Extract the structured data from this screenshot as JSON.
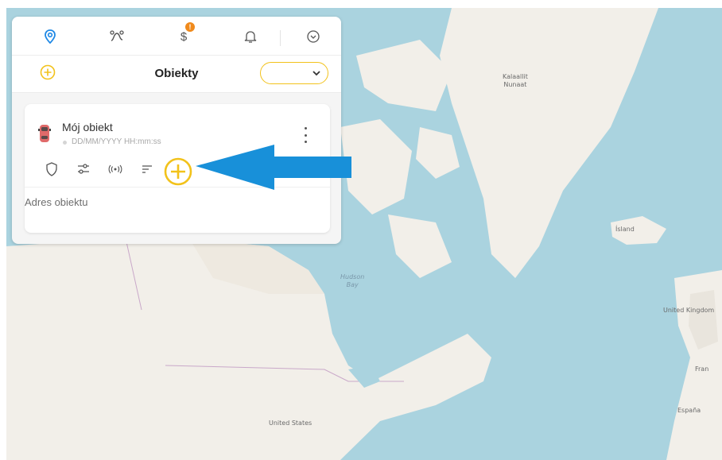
{
  "nav": {
    "tabs": [
      {
        "icon": "location-pin-icon",
        "active": true
      },
      {
        "icon": "route-icon"
      },
      {
        "icon": "dollar-icon",
        "badge": "!"
      },
      {
        "icon": "bell-icon"
      },
      {
        "icon": "chevron-circle-icon"
      }
    ]
  },
  "header": {
    "title": "Obiekty",
    "add_icon": "plus-circle-icon",
    "select_value": ""
  },
  "object": {
    "name": "Mój obiekt",
    "timestamp": "DD/MM/YYYY HH:mm:ss",
    "address": "Adres obiektu",
    "tools": [
      "shield-icon",
      "sliders-icon",
      "signal-icon",
      "sort-icon",
      "plus-circle-icon"
    ]
  },
  "map": {
    "labels": {
      "greenland": "Kalaallit\nNunaat",
      "iceland": "Ísland",
      "uk": "United Kingdom",
      "france": "Fran",
      "spain": "España",
      "hudson": "Hudson\nBay",
      "us": "United States"
    }
  },
  "colors": {
    "accent": "#f2c21b",
    "nav_active": "#1e88e5",
    "badge": "#f08a1c",
    "arrow": "#1890d9",
    "water": "#aad3df",
    "land": "#f2efe9"
  }
}
